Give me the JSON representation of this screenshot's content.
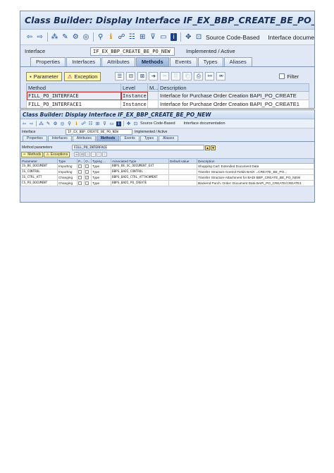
{
  "screenshot1": {
    "title": "Class Builder: Display Interface IF_EX_BBP_CREATE_BE_PO_NEW",
    "toolbar": {
      "icons": [
        "back-icon",
        "forward-icon",
        "other-object-icon",
        "display-change-icon",
        "activate-icon",
        "check-icon",
        "where-used-icon",
        "info-icon",
        "hierarchy-icon",
        "object-list-icon",
        "display-object-list-icon",
        "window-icon",
        "help-icon",
        "settings-icon"
      ],
      "source_code_based": "Source Code-Based",
      "interface_doc": "Interface docume"
    },
    "interface": {
      "label": "Interface",
      "value": "IF_EX_BBP_CREATE_BE_PO_NEW",
      "status": "Implemented / Active"
    },
    "tabs": [
      "Properties",
      "Interfaces",
      "Attributes",
      "Methods",
      "Events",
      "Types",
      "Aliases"
    ],
    "active_tab": "Methods",
    "actions": {
      "parameter": "Parameter",
      "exception": "Exception",
      "filter": "Filter"
    },
    "grid": {
      "columns": [
        "Method",
        "Level",
        "M...",
        "Description"
      ],
      "rows": [
        {
          "method": "FILL_PO_INTERFACE",
          "level": "Instance",
          "m": "",
          "description": "Interface for Purchase Order Creation BAPI_PO_CREATE"
        },
        {
          "method": "FILL_PO_INTERFACE1",
          "level": "Instance",
          "m": "",
          "description": "Interface for Purchase Order Creation BAPI_PO_CREATE1"
        }
      ]
    }
  },
  "screenshot2": {
    "title": "Class Builder: Display Interface IF_EX_BBP_CREATE_BE_PO_NEW",
    "toolbar": {
      "source_code_based": "Source Code-Based",
      "interface_doc": "Interface documentation"
    },
    "interface": {
      "label": "Interface",
      "value": "IF_EX_BBP_CREATE_BE_PO_NEW",
      "status": "Implemented / Active"
    },
    "tabs": [
      "Properties",
      "Interfaces",
      "Attributes",
      "Methods",
      "Events",
      "Types",
      "Aliases"
    ],
    "active_tab": "Methods",
    "method_params": {
      "label": "Method parameters",
      "value": "FILL_PO_INTERFACE"
    },
    "actions": {
      "methods": "Methods",
      "exceptions": "Exceptions"
    },
    "grid": {
      "columns": [
        "Parameter",
        "Type",
        "P...",
        "O...",
        "Typing ...",
        "Associated Type",
        "Default value",
        "Description"
      ],
      "rows": [
        {
          "parameter": "IS_BE_DOCUMENT",
          "type": "Importing",
          "p": false,
          "o": false,
          "typing": "Type",
          "assoc": "BBPS_BE_SC_DOCUMENT_EXT",
          "default": "",
          "description": "Shopping Cart: Extended Document Data"
        },
        {
          "parameter": "IS_CONTROL",
          "type": "Importing",
          "p": false,
          "o": false,
          "typing": "Type",
          "assoc": "BBPS_BADI_CONTROL",
          "default": "",
          "description": "Transfer Structure Control Fields BADI ...CREATE_BE_PO..."
        },
        {
          "parameter": "IS_CTRL_ATT",
          "type": "Changing",
          "p": false,
          "o": true,
          "typing": "Type",
          "assoc": "BBPS_BADI_CTRL_ATTACHMENT",
          "default": "",
          "description": "Transfer Structure Attachment for BADI BBP_CREATE_BE_PO_NEW"
        },
        {
          "parameter": "CS_PO_DOCUMENT",
          "type": "Changing",
          "p": false,
          "o": false,
          "typing": "Type",
          "assoc": "BBPS_BADI_PO_CREATE",
          "default": "",
          "description": "Backend Purch. Order: Document Data BAPI_PO_CREATE/CREATE1"
        }
      ]
    }
  }
}
